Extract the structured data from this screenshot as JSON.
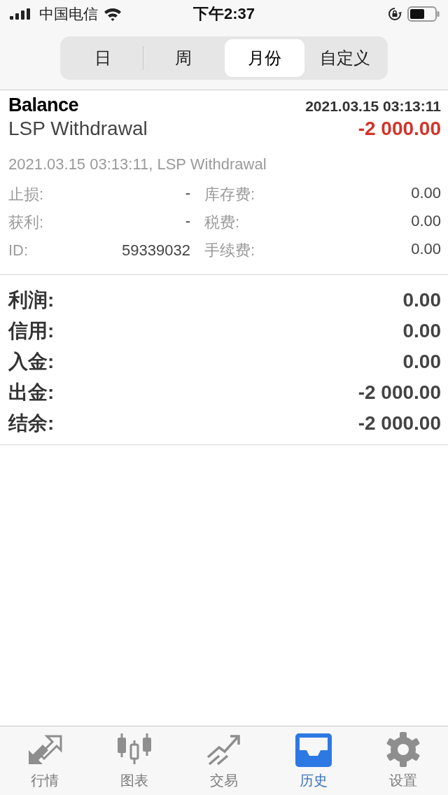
{
  "status_bar": {
    "carrier": "中国电信",
    "time": "下午2:37"
  },
  "segments": [
    {
      "label": "日",
      "selected": false
    },
    {
      "label": "周",
      "selected": false
    },
    {
      "label": "月份",
      "selected": true
    },
    {
      "label": "自定义",
      "selected": false
    }
  ],
  "deal": {
    "type": "Balance",
    "date": "2021.03.15 03:13:11",
    "comment": "LSP Withdrawal",
    "amount": "-2 000.00",
    "negative": true,
    "detail": "2021.03.15 03:13:11, LSP Withdrawal",
    "fields": [
      {
        "label": "止损:",
        "value": "-",
        "label_2": "库存费:",
        "value_2": "0.00"
      },
      {
        "label": "获利:",
        "value": "-",
        "label_2": "税费:",
        "value_2": "0.00"
      },
      {
        "label": "ID:",
        "value": "59339032",
        "label_2": "手续费:",
        "value_2": "0.00"
      }
    ]
  },
  "summary": [
    {
      "label": "利润:",
      "value": "0.00"
    },
    {
      "label": "信用:",
      "value": "0.00"
    },
    {
      "label": "入金:",
      "value": "0.00"
    },
    {
      "label": "出金:",
      "value": "-2 000.00"
    },
    {
      "label": "结余:",
      "value": "-2 000.00"
    }
  ],
  "tab_bar": [
    {
      "kind": "quotes",
      "label": "行情",
      "selected": false
    },
    {
      "kind": "chart",
      "label": "图表",
      "selected": false
    },
    {
      "kind": "trade",
      "label": "交易",
      "selected": false
    },
    {
      "kind": "history",
      "label": "历史",
      "selected": true
    },
    {
      "kind": "settings",
      "label": "设置",
      "selected": false
    }
  ]
}
